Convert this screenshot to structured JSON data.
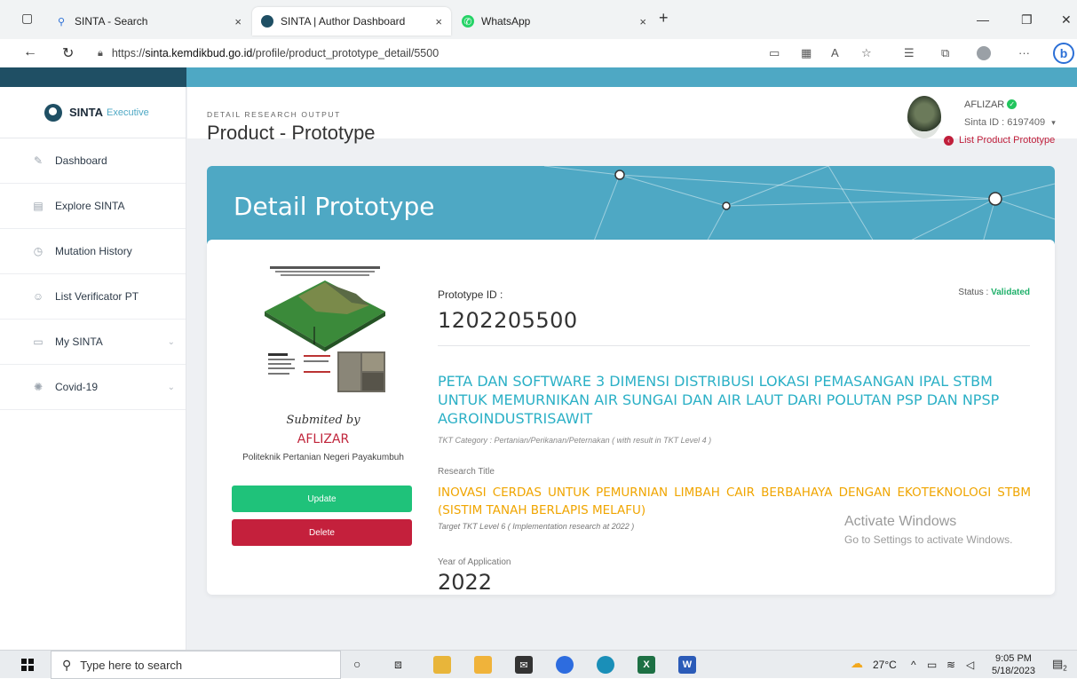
{
  "browser": {
    "tabs": [
      {
        "label": "SINTA - Search",
        "icon": "search-icon"
      },
      {
        "label": "SINTA | Author Dashboard",
        "icon": "sinta-logo-icon"
      },
      {
        "label": "WhatsApp",
        "icon": "whatsapp-icon"
      }
    ],
    "new_tab": "+",
    "close_glyph": "×",
    "url_prefix": "https://",
    "url_host": "sinta.kemdikbud.go.id",
    "url_path": "/profile/product_prototype_detail/5500"
  },
  "sidebar": {
    "brand_name": "SINTA",
    "brand_sub": "Executive",
    "items": [
      {
        "label": "Dashboard",
        "icon": "pencil-icon"
      },
      {
        "label": "Explore SINTA",
        "icon": "document-icon"
      },
      {
        "label": "Mutation History",
        "icon": "history-icon"
      },
      {
        "label": "List Verificator PT",
        "icon": "user-icon"
      },
      {
        "label": "My SINTA",
        "icon": "card-icon",
        "expandable": true
      },
      {
        "label": "Covid-19",
        "icon": "virus-icon",
        "expandable": true
      }
    ]
  },
  "header": {
    "user_name": "AFLIZAR",
    "sinta_id": "Sinta ID : 6197409"
  },
  "content": {
    "breadcrumb": "DETAIL RESEARCH OUTPUT",
    "page_title": "Product - Prototype",
    "list_link": "List Product Prototype",
    "banner_title": "Detail Prototype",
    "submitted_by": "Submited by",
    "author": "AFLIZAR",
    "institution": "Politeknik Pertanian Negeri Payakumbuh",
    "update_label": "Update",
    "delete_label": "Delete",
    "prototype_id_label": "Prototype ID :",
    "prototype_id": "1202205500",
    "status_label": "Status :",
    "status_value": "Validated",
    "product_title": "PETA DAN SOFTWARE 3 DIMENSI DISTRIBUSI LOKASI PEMASANGAN IPAL STBM UNTUK MEMURNIKAN AIR SUNGAI DAN AIR LAUT DARI POLUTAN PSP DAN NPSP AGROINDUSTRISAWIT",
    "tkt_category": "TKT Category : Pertanian/Perikanan/Peternakan ( with result in TKT Level  4 )",
    "research_title_label": "Research Title",
    "research_title": "INOVASI CERDAS UNTUK PEMURNIAN LIMBAH CAIR BERBAHAYA DENGAN EKOTEKNOLOGI STBM (SISTIM TANAH BERLAPIS MELAFU)",
    "target_tkt": "Target TKT Level 6 ( Implementation research at  2022 )",
    "year_label": "Year of Application",
    "year_value": "2022"
  },
  "watermark": {
    "line1": "Activate Windows",
    "line2": "Go to Settings to activate Windows."
  },
  "taskbar": {
    "search_placeholder": "Type here to search",
    "temperature": "27°C",
    "time": "9:05 PM",
    "date": "5/18/2023",
    "notification_count": "2"
  },
  "colors": {
    "accent": "#4ea8c4",
    "dark": "#1f4f64",
    "validated": "#1fb06a",
    "danger": "#c4203c",
    "title_cyan": "#2bb0c6",
    "research_orange": "#f0a500"
  }
}
